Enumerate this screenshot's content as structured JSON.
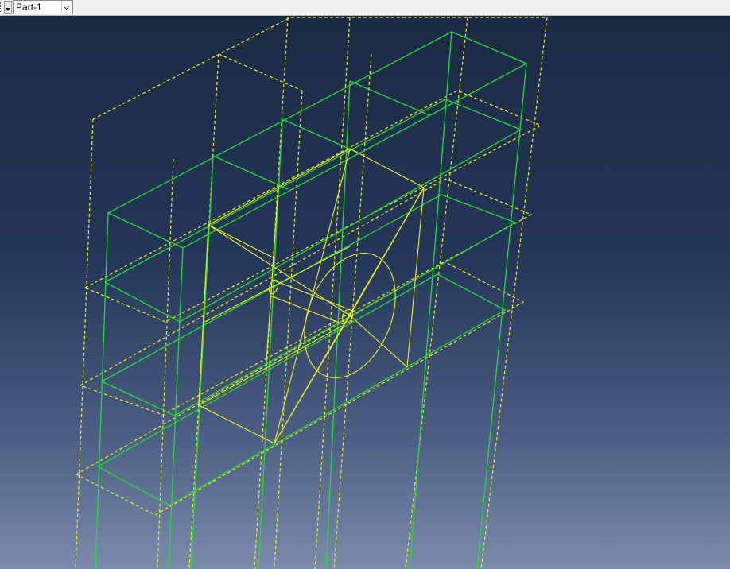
{
  "toolbar": {
    "part_select": {
      "value": "Part-1"
    }
  },
  "viewport": {
    "background_top": "#1b2a44",
    "background_bottom": "#7a8bab",
    "colors": {
      "solid_edges": "#22dd33",
      "datum_planes": "#f2ee1a",
      "partition_edges": "#f2ee1a"
    }
  }
}
